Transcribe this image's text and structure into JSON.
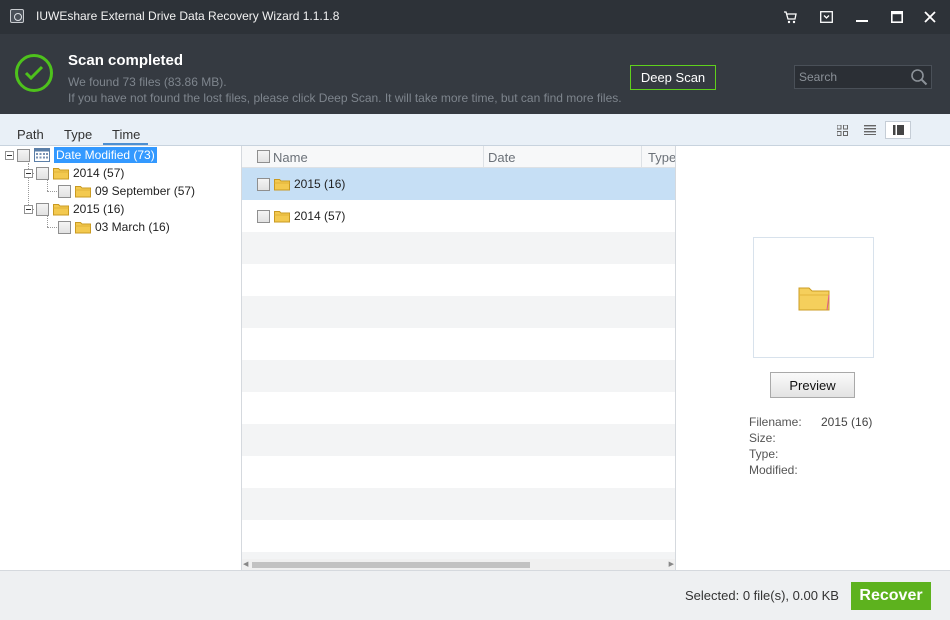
{
  "window": {
    "title": "IUWEshare External Drive Data Recovery Wizard 1.1.1.8",
    "controls": [
      "cart-icon",
      "menu-icon",
      "minimize-icon",
      "maximize-icon",
      "close-icon"
    ]
  },
  "header": {
    "status_title": "Scan completed",
    "found_text": "We found 73 files (83.86 MB).",
    "hint_text": "If you have not found the lost files, please click Deep Scan. It will take more time, but can find more files.",
    "deep_scan_label": "Deep Scan",
    "search_placeholder": "Search",
    "accent_color": "#5fd01c"
  },
  "tabs": [
    {
      "label": "Path"
    },
    {
      "label": "Type"
    },
    {
      "label": "Time",
      "active": true
    }
  ],
  "view_modes": [
    "grid-view-icon",
    "list-view-icon",
    "detail-view-icon"
  ],
  "tree": {
    "root": {
      "label": "Date Modified (73)",
      "icon": "calendar-icon"
    },
    "nodes": [
      {
        "label": "2014 (57)",
        "children": [
          {
            "label": "09 September (57)"
          }
        ]
      },
      {
        "label": "2015 (16)",
        "children": [
          {
            "label": "03 March (16)"
          }
        ]
      }
    ]
  },
  "file_list": {
    "columns": [
      "Name",
      "Date",
      "Type"
    ],
    "rows": [
      {
        "name": "2015 (16)",
        "selected": true
      },
      {
        "name": "2014 (57)",
        "selected": false
      }
    ]
  },
  "preview": {
    "button_label": "Preview",
    "labels": {
      "filename": "Filename:",
      "size": "Size:",
      "type": "Type:",
      "modified": "Modified:"
    },
    "values": {
      "filename": "2015 (16)",
      "size": "",
      "type": "",
      "modified": ""
    }
  },
  "footer": {
    "selected_text": "Selected: 0 file(s), 0.00 KB",
    "recover_label": "Recover",
    "recover_color": "#5db21e"
  }
}
